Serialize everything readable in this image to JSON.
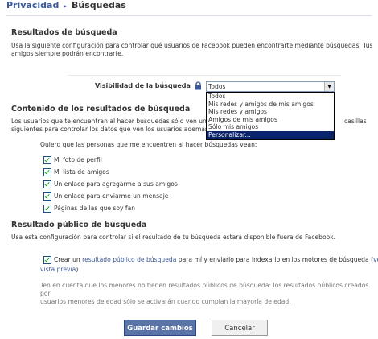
{
  "breadcrumb": {
    "parent": "Privacidad",
    "separator": "▸",
    "current": "Búsquedas"
  },
  "search_results": {
    "heading": "Resultados de búsqueda",
    "description_line1": "Usa la siguiente configuración para controlar qué usuarios de Facebook pueden encontrarte mediante búsquedas. Tus",
    "description_line2": "amigos siempre podrán encontrarte.",
    "visibility_label": "Visibilidad de la búsqueda",
    "selected_value": "Todos",
    "options": [
      "Todos",
      "Mis redes y amigos de mis amigos",
      "Mis redes y amigos",
      "Amigos de mis amigos",
      "Sólo mis amigos",
      "Personalizar..."
    ],
    "highlighted_option": "Personalizar..."
  },
  "content": {
    "heading": "Contenido de los resultados de búsqueda",
    "description_line1": "Los usuarios que te encuentran al hacer búsquedas sólo ven una",
    "description_line1_end": "casillas",
    "description_line2": "siguientes para controlar los datos que ven los usuarios además d",
    "prompt": "Quiero que las personas que me encuentren al hacer búsquedas vean:",
    "checkboxes": [
      {
        "label": "Mi foto de perfil",
        "checked": true
      },
      {
        "label": "Mi lista de amigos",
        "checked": true
      },
      {
        "label": "Un enlace para agregarme a sus amigos",
        "checked": true
      },
      {
        "label": "Un enlace para enviarme un mensaje",
        "checked": true
      },
      {
        "label": "Páginas de las que soy fan",
        "checked": true
      }
    ]
  },
  "public": {
    "heading": "Resultado público de búsqueda",
    "description": "Usa esta configuración para controlar si el resultado de tu búsqueda estará disponible fuera de Facebook.",
    "checkbox_prefix": "Crear un ",
    "checkbox_link": "resultado público de búsqueda",
    "checkbox_suffix": " para mí y enviarlo para indexarlo en los motores de búsqueda (",
    "checkbox_link2_part1": "ver",
    "checkbox_link2_part2": "vista previa",
    "checkbox_close": ")",
    "checked": true,
    "note_line1": "Ten en cuenta que los menores no tienen resultados públicos de búsqueda: los resultados públicos creados por",
    "note_line2": "usuarios menores de edad sólo se activarán cuando cumplan la mayoría de edad."
  },
  "buttons": {
    "save": "Guardar cambios",
    "cancel": "Cancelar"
  },
  "colors": {
    "link": "#3b5998",
    "primary_button": "#5b74a8",
    "highlight": "#0a246a"
  }
}
